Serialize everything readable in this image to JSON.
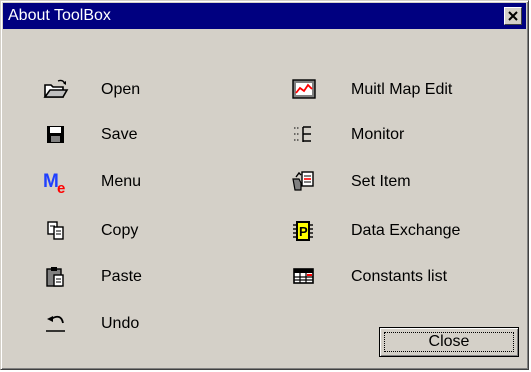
{
  "window": {
    "title": "About ToolBox",
    "close_glyph": "×"
  },
  "left_items": [
    {
      "label": "Open",
      "icon": "open-folder-icon"
    },
    {
      "label": "Save",
      "icon": "floppy-disk-icon"
    },
    {
      "label": "Menu",
      "icon": "menu-me-icon",
      "icon_text": [
        "M",
        "e"
      ]
    },
    {
      "label": "Copy",
      "icon": "copy-icon"
    },
    {
      "label": "Paste",
      "icon": "paste-clipboard-icon"
    },
    {
      "label": "Undo",
      "icon": "undo-icon"
    }
  ],
  "right_items": [
    {
      "label": "Muitl Map Edit",
      "icon": "map-chart-icon"
    },
    {
      "label": "Monitor",
      "icon": "monitor-list-icon"
    },
    {
      "label": "Set Item",
      "icon": "set-item-icon"
    },
    {
      "label": "Data Exchange",
      "icon": "data-exchange-chip-icon",
      "icon_text": "P"
    },
    {
      "label": "Constants list",
      "icon": "grid-table-icon"
    }
  ],
  "buttons": {
    "close_label": "Close"
  },
  "colors": {
    "face": "#d4d0c8",
    "titlebar": "#000080",
    "me_blue": "#2040ff",
    "me_red": "#ff0000"
  }
}
